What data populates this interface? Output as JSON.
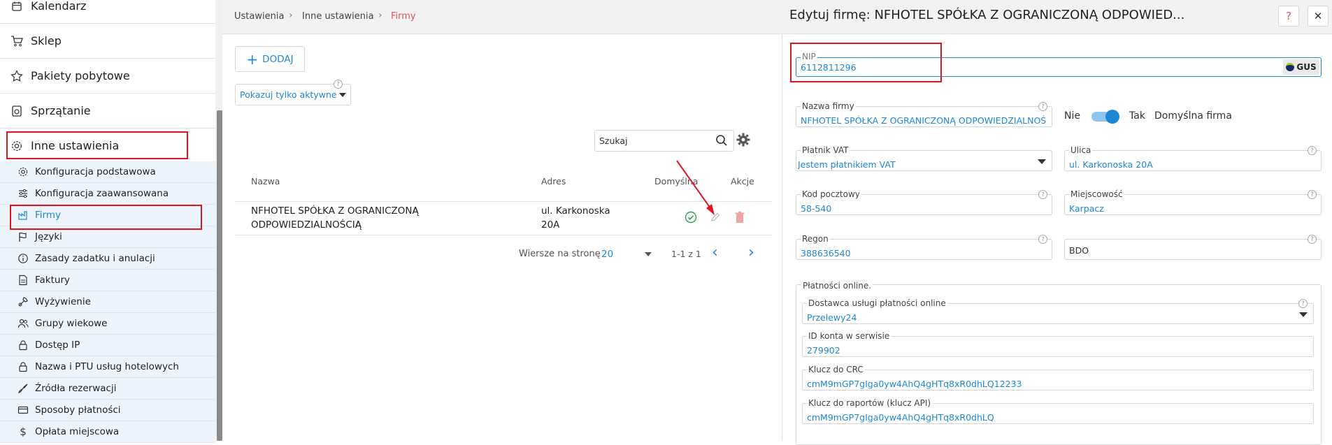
{
  "sidebar": {
    "main_items": [
      {
        "label": "Kalendarz",
        "icon": "calendar-icon"
      },
      {
        "label": "Sklep",
        "icon": "cart-icon"
      },
      {
        "label": "Pakiety pobytowe",
        "icon": "star-icon"
      },
      {
        "label": "Sprzątanie",
        "icon": "cleaning-icon"
      },
      {
        "label": "Inne ustawienia",
        "icon": "gear-icon"
      }
    ],
    "sub_items": [
      {
        "label": "Konfiguracja podstawowa",
        "icon": "gear-icon"
      },
      {
        "label": "Konfiguracja zaawansowana",
        "icon": "sliders-icon"
      },
      {
        "label": "Firmy",
        "icon": "factory-icon",
        "active": true
      },
      {
        "label": "Języki",
        "icon": "flag-icon"
      },
      {
        "label": "Zasady zadatku i anulacji",
        "icon": "info-icon"
      },
      {
        "label": "Faktury",
        "icon": "document-icon"
      },
      {
        "label": "Wyżywienie",
        "icon": "food-icon"
      },
      {
        "label": "Grupy wiekowe",
        "icon": "users-icon"
      },
      {
        "label": "Dostęp IP",
        "icon": "lock-icon"
      },
      {
        "label": "Nazwa i PTU usług hotelowych",
        "icon": "lock-icon"
      },
      {
        "label": "Źródła rezerwacji",
        "icon": "source-icon"
      },
      {
        "label": "Sposoby płatności",
        "icon": "card-icon"
      },
      {
        "label": "Opłata miejscowa",
        "icon": "dollar-icon"
      }
    ]
  },
  "breadcrumb": {
    "items": [
      "Ustawienia",
      "Inne ustawienia"
    ],
    "current": "Firmy"
  },
  "main": {
    "add_label": "DODAJ",
    "add_icon": "plus-icon",
    "filter_label": "Pokazuj tylko aktywne",
    "search_placeholder": "Szukaj",
    "table": {
      "headers": {
        "name": "Nazwa",
        "address": "Adres",
        "default": "Domyślna",
        "actions": "Akcje"
      },
      "rows": [
        {
          "name_line1": "NFHOTEL SPÓŁKA Z OGRANICZONĄ",
          "name_line2": "ODPOWIEDZIALNOŚCIĄ",
          "address_line1": "ul. Karkonoska",
          "address_line2": "20A",
          "default": true
        }
      ]
    },
    "pagination": {
      "rows_label": "Wiersze na stronę",
      "rows_value": "20",
      "range": "1-1 z 1"
    }
  },
  "panel": {
    "title": "Edytuj firmę: NFHOTEL SPÓŁKA Z OGRANICZONĄ ODPOWIED...",
    "help_label": "?",
    "close_label": "✕",
    "nip": {
      "label": "NIP",
      "value": "6112811296",
      "gus_label": "GUS"
    },
    "company_name": {
      "label": "Nazwa firmy",
      "value": "NFHOTEL SPÓŁKA Z OGRANICZONĄ ODPOWIEDZIALNOŚCIĄ"
    },
    "default_toggle": {
      "off_label": "Nie",
      "on_label": "Tak",
      "caption": "Domyślna firma",
      "value": true
    },
    "vat": {
      "label": "Płatnik VAT",
      "value": "Jestem płatnikiem VAT"
    },
    "street": {
      "label": "Ulica",
      "value": "ul. Karkonoska 20A"
    },
    "postal": {
      "label": "Kod pocztowy",
      "value": "58-540"
    },
    "city": {
      "label": "Miejscowość",
      "value": "Karpacz"
    },
    "regon": {
      "label": "Regon",
      "value": "388636540"
    },
    "bdo": {
      "label": "BDO",
      "value": ""
    },
    "online_payments": {
      "section_label": "Płatności online.",
      "provider": {
        "label": "Dostawca usługi płatności online",
        "value": "Przelewy24"
      },
      "account_id": {
        "label": "ID konta w serwisie",
        "value": "279902"
      },
      "crc_key": {
        "label": "Klucz do CRC",
        "value": "cmM9mGP7gIga0yw4AhQ4gHTq8xR0dhLQ12233"
      },
      "api_key": {
        "label": "Klucz do raportów (klucz API)",
        "value": "cmM9mGP7gIga0yw4AhQ4gHTq8xR0dhLQ"
      }
    }
  },
  "colors": {
    "accent": "#1e88d6",
    "highlight": "#e0161c",
    "breadcrumb_current": "#e0565b",
    "delete": "#f2a3a3",
    "check": "#2e9e4e"
  }
}
